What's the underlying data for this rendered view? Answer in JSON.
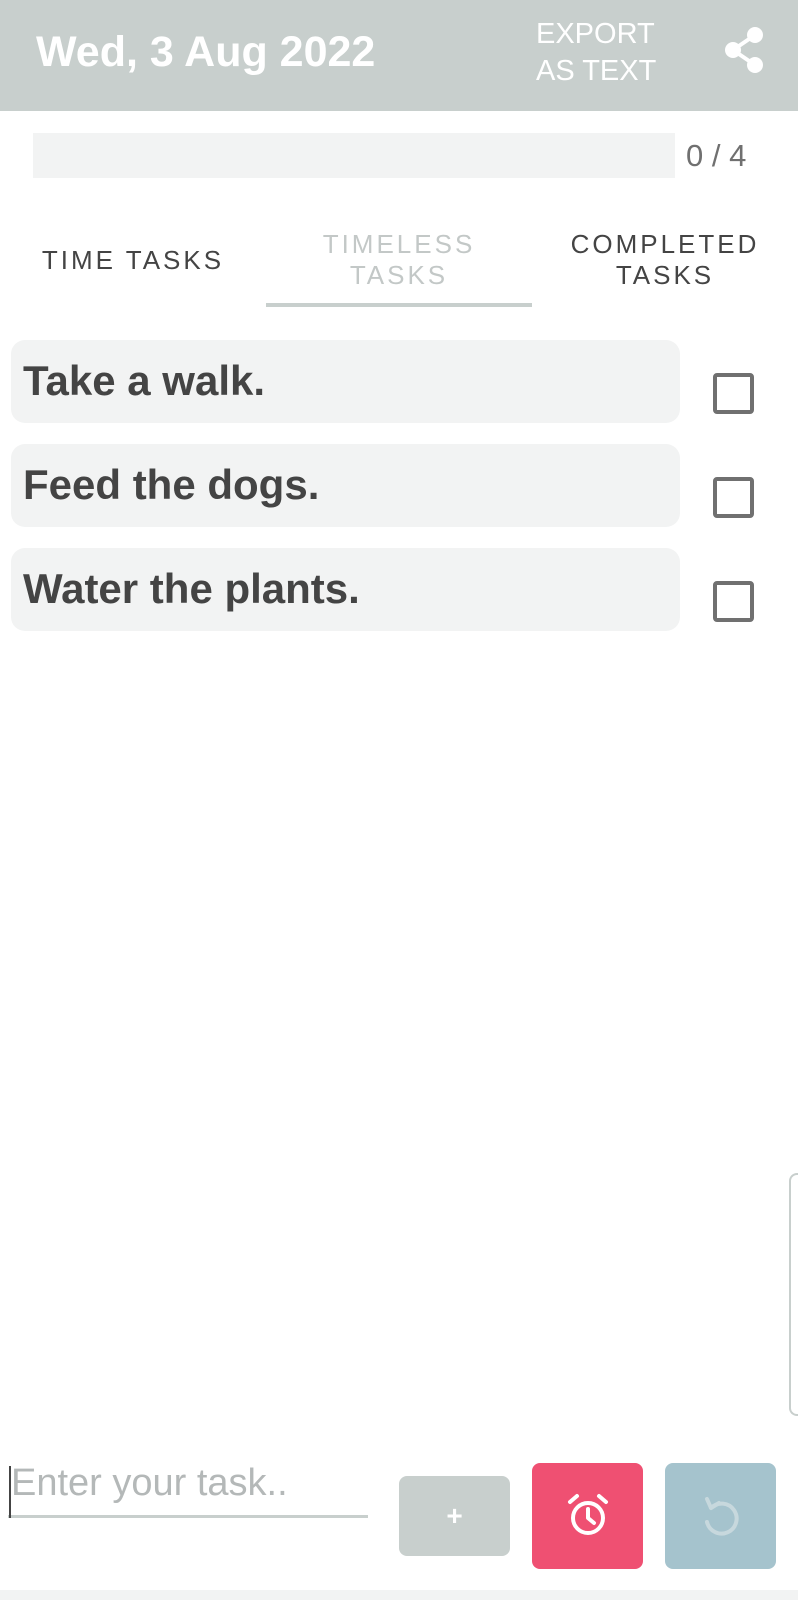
{
  "app_bar": {
    "date": "Wed, 3 Aug 2022",
    "export_label": "EXPORT AS TEXT",
    "share_icon": "share-icon",
    "background_color": "#c8cfcd"
  },
  "progress": {
    "completed": 0,
    "total": 4,
    "label": "0 / 4"
  },
  "tabs": [
    {
      "label": "TIME TASKS",
      "active": false
    },
    {
      "label": "TIMELESS TASKS",
      "active": true
    },
    {
      "label": "COMPLETED TASKS",
      "active": false
    }
  ],
  "tasks": [
    {
      "text": "Take a walk.",
      "checked": false
    },
    {
      "text": "Feed the dogs.",
      "checked": false
    },
    {
      "text": "Water the plants.",
      "checked": false
    }
  ],
  "input": {
    "placeholder": "Enter your task..",
    "value": ""
  },
  "buttons": {
    "add_label": "+",
    "alarm_icon": "alarm-icon",
    "undo_icon": "undo-icon"
  },
  "colors": {
    "alarm_button": "#ef5072",
    "undo_button": "#a5c3cd",
    "add_button": "#c8cfcd",
    "text": "#444444"
  }
}
